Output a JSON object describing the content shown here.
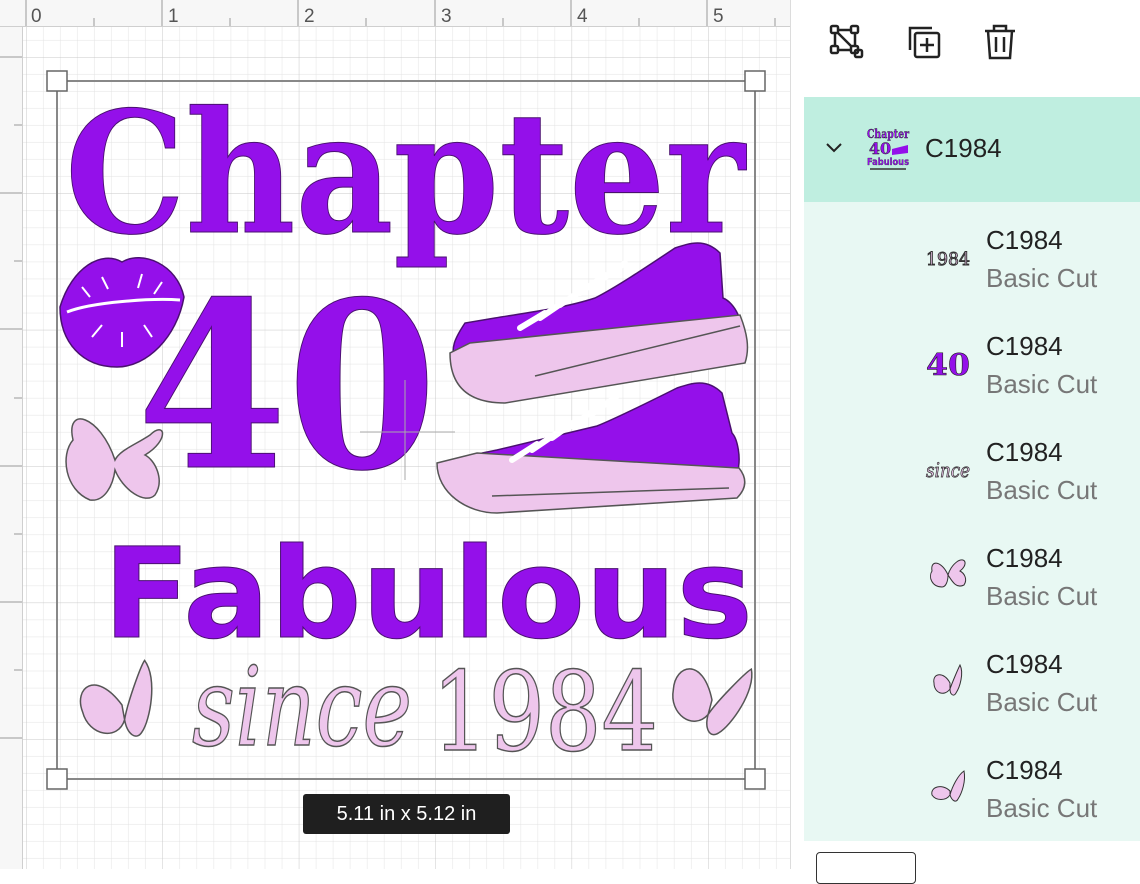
{
  "ruler": {
    "top_marks": [
      "0",
      "1",
      "2",
      "3",
      "4",
      "5"
    ]
  },
  "design": {
    "line1": "Chapter",
    "line2": "40",
    "line3": "Fabulous",
    "line4_script": "since",
    "line4_year": "1984",
    "colors": {
      "purple": "#9410ea",
      "pink": "#eec6ec",
      "outline": "#555555"
    }
  },
  "size_badge": "5.11  in x 5.12  in",
  "toolbar": {
    "icons": [
      "ungroup-icon",
      "duplicate-icon",
      "delete-icon"
    ]
  },
  "layers_panel": {
    "group_name": "C1984",
    "group_thumb_text": [
      "Chapter",
      "40",
      "Fabulous"
    ],
    "layers": [
      {
        "name": "C1984",
        "type": "Basic Cut",
        "thumb_text": "1984"
      },
      {
        "name": "C1984",
        "type": "Basic Cut",
        "thumb_text": "40"
      },
      {
        "name": "C1984",
        "type": "Basic Cut",
        "thumb_text": "since"
      },
      {
        "name": "C1984",
        "type": "Basic Cut",
        "thumb_text": ""
      },
      {
        "name": "C1984",
        "type": "Basic Cut",
        "thumb_text": ""
      },
      {
        "name": "C1984",
        "type": "Basic Cut",
        "thumb_text": ""
      }
    ]
  }
}
